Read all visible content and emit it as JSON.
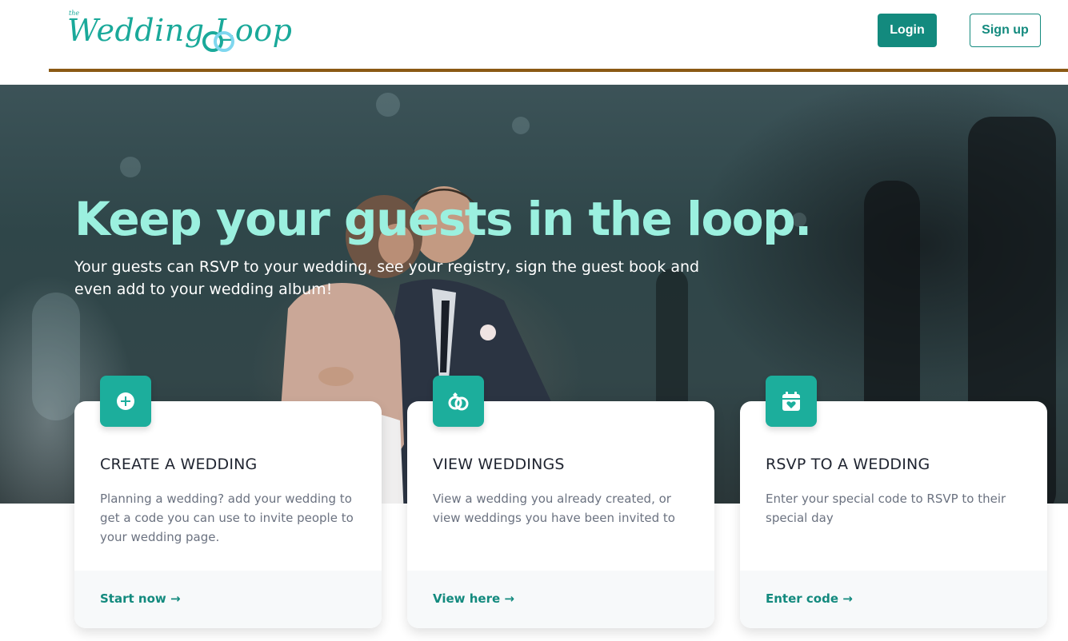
{
  "header": {
    "logo_small": "the",
    "logo_text": "Wedding Loop",
    "login_label": "Login",
    "signup_label": "Sign up"
  },
  "hero": {
    "title": "Keep your guests in the loop.",
    "subtitle": "Your guests can RSVP to your wedding, see your registry, sign the guest book and even add to your wedding album!"
  },
  "cards": [
    {
      "icon": "plus-circle-icon",
      "title": "CREATE A WEDDING",
      "description": "Planning a wedding? add your wedding to get a code you can use to invite people to your wedding page.",
      "link": "Start now →"
    },
    {
      "icon": "rings-icon",
      "title": "VIEW WEDDINGS",
      "description": "View a wedding you already created, or view weddings you have been invited to",
      "link": "View here →"
    },
    {
      "icon": "calendar-heart-icon",
      "title": "RSVP TO A WEDDING",
      "description": "Enter your special code to RSVP to their special day",
      "link": "Enter code →"
    }
  ],
  "colors": {
    "brand": "#1aa99a",
    "button": "#138a7e",
    "hero_title": "#9bf0df",
    "rule": "#8b5a14"
  }
}
